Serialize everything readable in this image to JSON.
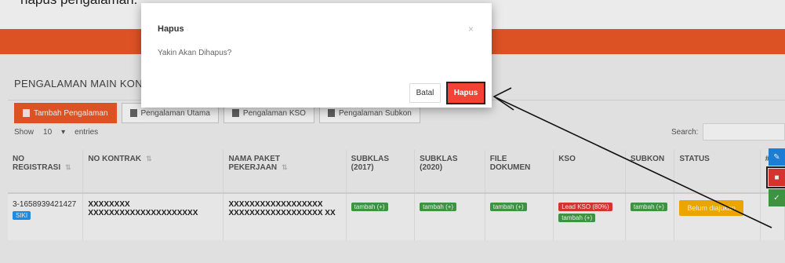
{
  "caption": "hapus pengalaman.",
  "page": {
    "title": "PENGALAMAN MAIN KONTRAK",
    "buttons": [
      {
        "label": "Tambah Pengalaman"
      },
      {
        "label": "Pengalaman Utama"
      },
      {
        "label": "Pengalaman KSO"
      },
      {
        "label": "Pengalaman Subkon"
      }
    ],
    "show_label": "Show",
    "show_value": "10",
    "entries_label": "entries",
    "search_label": "Search:"
  },
  "table": {
    "headers": [
      "NO REGISTRASI",
      "NO KONTRAK",
      "NAMA PAKET PEKERJAAN",
      "SUBKLAS (2017)",
      "SUBKLAS (2020)",
      "FILE DOKUMEN",
      "KSO",
      "SUBKON",
      "STATUS",
      "#"
    ],
    "row": {
      "registrasi": "3-1658939421427",
      "registrasi_badge": "SIKI",
      "kontrak": "XXXXXXXX XXXXXXXXXXXXXXXXXXXXX",
      "paket": "XXXXXXXXXXXXXXXXXX XXXXXXXXXXXXXXXXXX XX",
      "subklas2017": "tambah (+)",
      "subklas2020": "tambah (+)",
      "file": "tambah (+)",
      "kso_lead": "Lead KSO (80%)",
      "kso_add": "tambah (+)",
      "subkon": "tambah (+)",
      "status": "Belum diajukan"
    }
  },
  "modal": {
    "title": "Hapus",
    "close": "×",
    "body": "Yakin Akan Dihapus?",
    "cancel": "Batal",
    "confirm": "Hapus"
  },
  "colors": {
    "brand": "#f05a28",
    "danger": "#f44336",
    "success": "#43a047",
    "warning": "#ffb300",
    "info": "#1e88e5"
  }
}
